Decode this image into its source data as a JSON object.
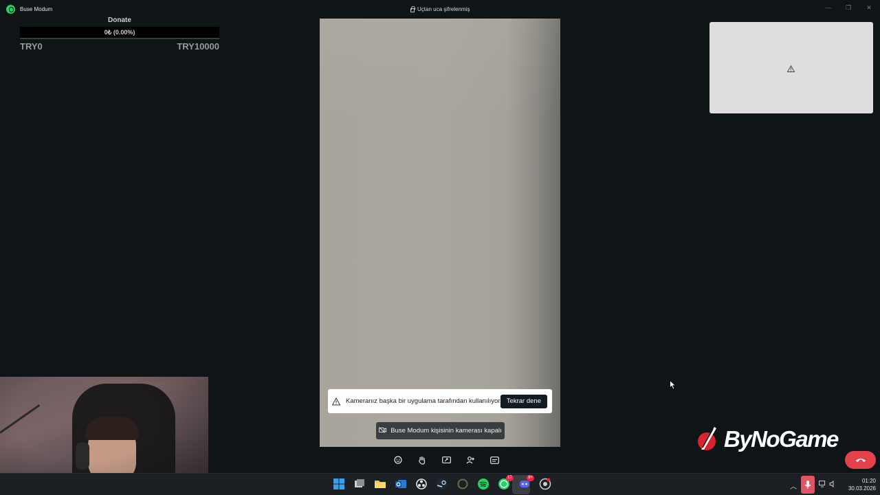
{
  "window": {
    "app_title": "Buse Modum",
    "encryption_label": "Uçtan uca şifrelenmiş",
    "minimize_glyph": "—",
    "maximize_glyph": "❐",
    "close_glyph": "✕"
  },
  "donate": {
    "title": "Donate",
    "progress_label": "0₺ (0.00%)",
    "progress_fraction": 0,
    "min_label": "TRY0",
    "max_label": "TRY10000"
  },
  "call": {
    "camera_alert": "Kameranız başka bir uygulama tarafından kullanılıyor.",
    "retry_label": "Tekrar dene",
    "remote_camera_off": "Buse Modum kişisinin kamerası kapalı",
    "controls": [
      "emoji-icon",
      "raise-hand-icon",
      "screen-share-icon",
      "add-person-icon",
      "captions-icon"
    ],
    "end_call_icon": "phone-hangup-icon"
  },
  "branding": {
    "logo_text": "ByNoGame"
  },
  "taskbar": {
    "apps": [
      {
        "name": "windows-start-icon"
      },
      {
        "name": "task-view-icon"
      },
      {
        "name": "file-explorer-icon"
      },
      {
        "name": "outlook-icon"
      },
      {
        "name": "obs-icon"
      },
      {
        "name": "steam-icon"
      },
      {
        "name": "app-ring-icon"
      },
      {
        "name": "spotify-icon"
      },
      {
        "name": "whatsapp-icon",
        "badge": "17"
      },
      {
        "name": "discord-icon",
        "badge": "9+"
      },
      {
        "name": "chrome-like-icon"
      }
    ],
    "time": "01:20",
    "date": "30.03.2026"
  },
  "colors": {
    "whatsapp_green": "#25d366",
    "end_call_red": "#e5414a",
    "mic_muted": "#e05563"
  }
}
